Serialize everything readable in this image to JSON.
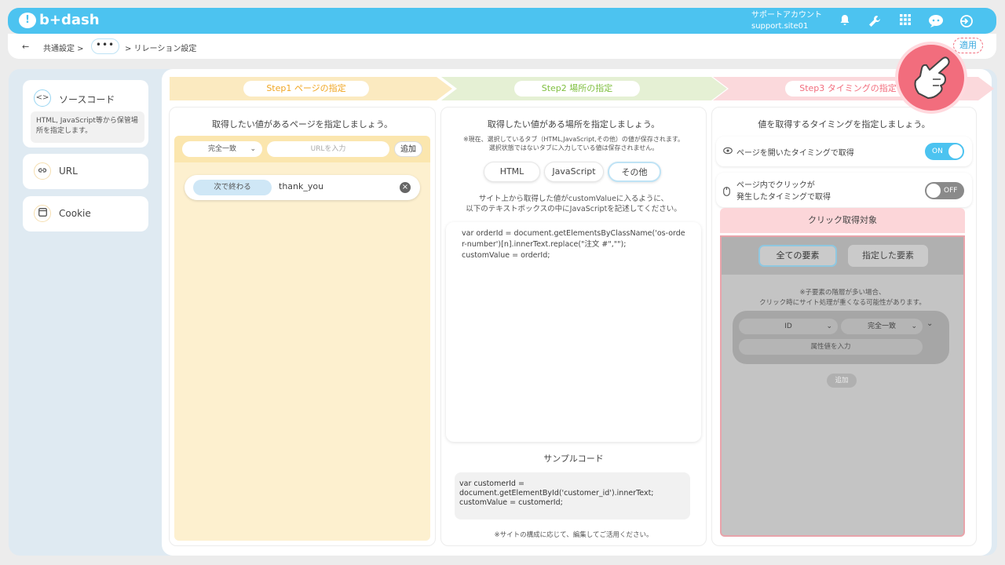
{
  "header": {
    "logo_text": "b+dash",
    "account_name": "サポートアカウント",
    "account_site": "support.site01"
  },
  "breadcrumb": {
    "back": "←",
    "item1": "共通設定 >",
    "dots": "•••",
    "item2": "> リレーション設定",
    "apply_label": "適用"
  },
  "sidebar": {
    "source": {
      "label": "ソースコード",
      "icon": "<>",
      "desc": "HTML, JavaScript等から保管場所を指定します。"
    },
    "url": {
      "label": "URL"
    },
    "cookie": {
      "label": "Cookie"
    }
  },
  "steps": [
    {
      "label": "Step1 ページの指定"
    },
    {
      "label": "Step2 場所の指定"
    },
    {
      "label": "Step3 タイミングの指定"
    }
  ],
  "step1": {
    "title": "取得したい値があるページを指定しましょう。",
    "match_select": "完全一致",
    "url_placeholder": "URLを入力",
    "add_label": "追加",
    "rule_type": "次で終わる",
    "rule_value": "thank_you"
  },
  "step2": {
    "title": "取得したい値がある場所を指定しましょう。",
    "note1": "※現在、選択しているタブ（HTML,JavaScript,その他）の値が保存されます。",
    "note2": "選択状態ではないタブに入力している値は保存されません。",
    "tabs": [
      "HTML",
      "JavaScript",
      "その他"
    ],
    "desc1": "サイト上から取得した値がcustomValueに入るように、",
    "desc2": "以下のテキストボックスの中にJavaScriptを記述してください。",
    "code_lines": [
      "var orderId = document.getElementsByClassName('os-orde",
      "r-number')[n].innerText.replace(\"注文 #\",\"\");",
      "customValue = orderId;"
    ],
    "sample_title": "サンプルコード",
    "sample_lines": [
      "var customerId =",
      "document.getElementById('customer_id').innerText;",
      "customValue = customerId;"
    ],
    "footer_note": "※サイトの構成に応じて、編集してご活用ください。"
  },
  "step3": {
    "title": "値を取得するタイミングを指定しましょう。",
    "option1": "ページを開いたタイミングで取得",
    "toggle_on": "ON",
    "option2_line1": "ページ内でクリックが",
    "option2_line2": "発生したタイミングで取得",
    "toggle_off": "OFF",
    "click_target": "クリック取得対象",
    "all_elements": "全ての要素",
    "specified_elements": "指定した要素",
    "warn1": "※子要素の階層が多い場合、",
    "warn2": "クリック時にサイト処理が重くなる可能性があります。",
    "id_select": "ID",
    "match_select": "完全一致",
    "attr_placeholder": "属性値を入力",
    "add_label": "追加"
  },
  "colors": {
    "brand": "#4cc3f0",
    "step1": "#fbeac0",
    "step2": "#e5f0d4",
    "step3": "#fbd9dc",
    "toggle_on": "#4cc3f0",
    "accent_pink": "#f26d7d"
  }
}
